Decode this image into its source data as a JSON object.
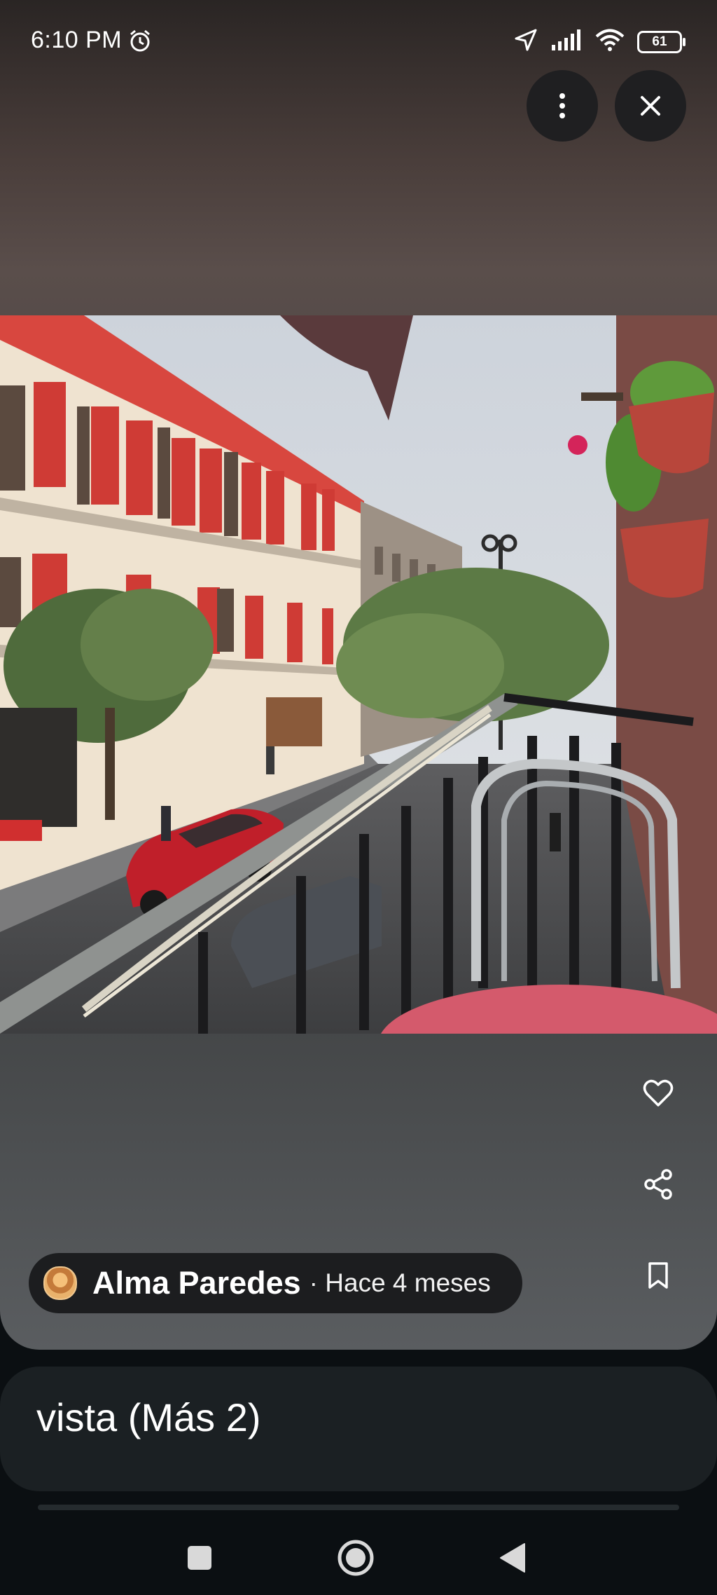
{
  "status": {
    "time": "6:10 PM",
    "battery": "61"
  },
  "icons": {
    "alarm": "alarm-icon",
    "location": "location-arrow-icon",
    "signal": "signal-icon",
    "wifi": "wifi-icon",
    "battery": "battery-icon",
    "more": "more-vert-icon",
    "close": "close-icon",
    "like": "heart-icon",
    "share": "share-icon",
    "save": "bookmark-icon",
    "recents": "square-icon",
    "home": "circle-icon",
    "back": "triangle-back-icon"
  },
  "photo": {
    "description_alt": "Vista desde balcón a calle con edificios rojos"
  },
  "author": {
    "name": "Alma Paredes",
    "time": "· Hace 4 meses"
  },
  "caption": {
    "text": "vista (Más 2)"
  },
  "colors": {
    "pill": "#1c1d1f",
    "card": "#1b2023",
    "facade": "#d8473f"
  }
}
